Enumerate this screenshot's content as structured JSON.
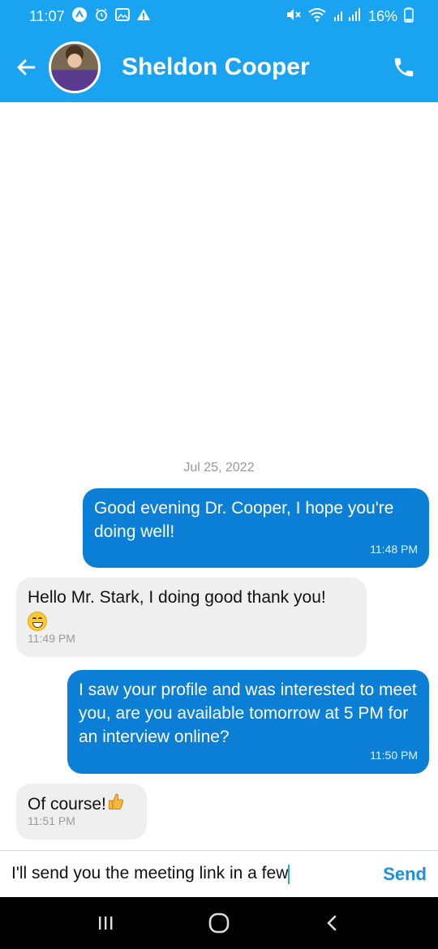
{
  "status_bar": {
    "time": "11:07",
    "battery": "16%",
    "left_icons": [
      "app-notification-icon",
      "alarm-icon",
      "gallery-icon",
      "warning-icon"
    ],
    "right_icons": [
      "mute-icon",
      "wifi-icon",
      "signal-icon",
      "battery-icon"
    ]
  },
  "header": {
    "contact_name": "Sheldon Cooper",
    "accent_color": "#1aa3f0"
  },
  "chat": {
    "date_label": "Jul 25, 2022",
    "messages": [
      {
        "direction": "outgoing",
        "text": "Good evening Dr. Cooper, I hope you're doing well!",
        "time": "11:48 PM"
      },
      {
        "direction": "incoming",
        "text": "Hello Mr. Stark, I doing good thank you!",
        "emoji": "grinning-face",
        "time": "11:49 PM"
      },
      {
        "direction": "outgoing",
        "text": "I saw your profile and was interested to meet you, are you available tomorrow at 5 PM for an interview online?",
        "time": "11:50 PM"
      },
      {
        "direction": "incoming",
        "text": "Of course!",
        "emoji": "thumbs-up",
        "time": "11:51 PM"
      }
    ],
    "outgoing_color": "#0a7fd5",
    "incoming_color": "#efefef"
  },
  "composer": {
    "value": "I'll send you the meeting link in a few",
    "send_label": "Send"
  }
}
